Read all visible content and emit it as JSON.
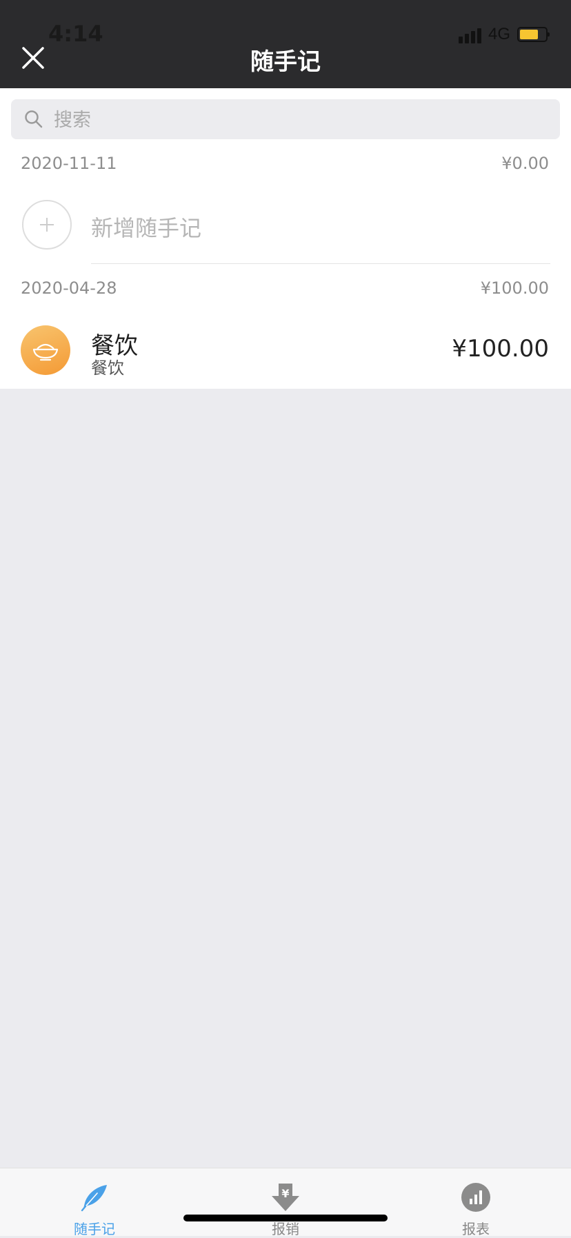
{
  "status_bar": {
    "time": "4:14",
    "network": "4G",
    "battery_color": "#f7c531"
  },
  "header": {
    "title": "随手记",
    "close_icon": "close-icon"
  },
  "search": {
    "placeholder": "搜索"
  },
  "groups": [
    {
      "date": "2020-11-11",
      "total": "¥0.00",
      "add_label": "新增随手记"
    },
    {
      "date": "2020-04-28",
      "total": "¥100.00",
      "entries": [
        {
          "icon": "rice-bowl-icon",
          "title": "餐饮",
          "subtitle": "餐饮",
          "amount": "¥100.00"
        }
      ]
    }
  ],
  "tabs": [
    {
      "label": "随手记",
      "icon": "feather-icon",
      "active": true
    },
    {
      "label": "报销",
      "icon": "reimburse-icon",
      "active": false
    },
    {
      "label": "报表",
      "icon": "chart-icon",
      "active": false
    }
  ],
  "colors": {
    "accent": "#4aa1e8",
    "header_bg": "#2b2b2d",
    "category_orange": "#f49a35"
  }
}
